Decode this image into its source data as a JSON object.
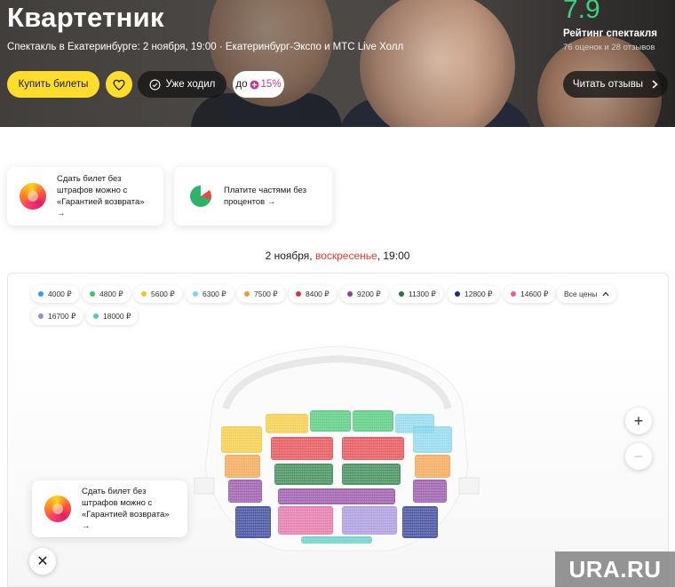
{
  "header": {
    "title": "Квартетник",
    "subtitle": "Спектакль в Екатеринбурге: 2 ноября, 19:00  ·  Екатеринбург-Экспо и МТС Live Холл",
    "buy_label": "Купить билеты",
    "went_label": "Уже ходил",
    "plus_prefix": "до",
    "plus_value": "15%",
    "reviews_label": "Читать отзывы",
    "rating_value": "7.9",
    "rating_label": "Рейтинг спектакля",
    "rating_count": "76 оценок и 28 отзывов"
  },
  "promo_cards": [
    {
      "text": "Сдать билет без штрафов можно с «Гарантией возврата» →",
      "icon": "refund-guarantee-icon"
    },
    {
      "text": "Платите частями без процентов →",
      "icon": "split-payment-icon"
    }
  ],
  "date_line": {
    "part1": "2 ноября, ",
    "weekday": "воскресенье",
    "part2": ", 19:00"
  },
  "price_filters": [
    {
      "label": "4000 ₽",
      "color": "#2fa3e6"
    },
    {
      "label": "4800 ₽",
      "color": "#3cc46b"
    },
    {
      "label": "5600 ₽",
      "color": "#f2c52a"
    },
    {
      "label": "6300 ₽",
      "color": "#7fd3ea"
    },
    {
      "label": "7500 ₽",
      "color": "#f29a3b"
    },
    {
      "label": "8400 ₽",
      "color": "#e2343c"
    },
    {
      "label": "9200 ₽",
      "color": "#8b3d9e"
    },
    {
      "label": "11300 ₽",
      "color": "#1f7a3c"
    },
    {
      "label": "12800 ₽",
      "color": "#1e2d8a"
    },
    {
      "label": "14600 ₽",
      "color": "#e0609b"
    },
    {
      "label": "16700 ₽",
      "color": "#9c8ad8"
    },
    {
      "label": "18000 ₽",
      "color": "#52c9c0"
    }
  ],
  "all_prices_label": "Все цены",
  "map_promo": {
    "text": "Сдать билет без штрафов можно с «Гарантией возврата» →"
  },
  "zoom": {
    "in": "+",
    "out": "−"
  },
  "close_symbol": "✕",
  "watermark": "URA.RU"
}
